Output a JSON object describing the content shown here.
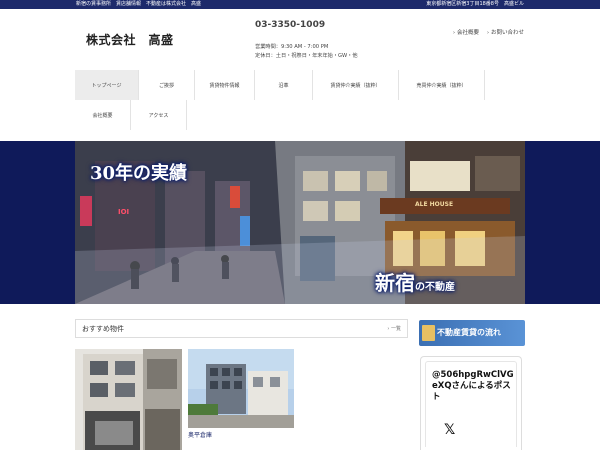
{
  "topbar": {
    "left": "新宿の賃事務所　賃店舗情報　不動産は株式会社　高盛",
    "right": "東京都新宿区新宿3丁目18番8号　高盛ビル"
  },
  "header": {
    "company": "株式会社　高盛",
    "phone": "03-3350-1009",
    "hours": "営業時間：9:30 AM - 7:00 PM",
    "holidays": "定休日：土日・祝祭日・年末年始・GW・他",
    "links": [
      "会社概要",
      "お問い合わせ"
    ]
  },
  "nav": {
    "row1": [
      "トップページ",
      "ご挨拶",
      "賃貸物件情報",
      "沿革",
      "賃貸仲介実績（抜粋）",
      "売買仲介実績（抜粋）"
    ],
    "row2": [
      "会社概要",
      "アクセス"
    ]
  },
  "hero": {
    "headline": "30年の実績",
    "tagline_main": "新宿",
    "tagline_sub": "の不動産",
    "bar_sign": "ALE HOUSE",
    "shop_sign": "IOI"
  },
  "featured": {
    "title": "おすすめ物件",
    "more": "一覧",
    "cards": [
      {
        "caption": ""
      },
      {
        "caption": "奥平倉庫"
      }
    ]
  },
  "sidebar": {
    "banner": "不動産賃貸の流れ",
    "x_title": "@506hpgRwClVGeXQさんによるポスト",
    "x_logo": "𝕏"
  }
}
